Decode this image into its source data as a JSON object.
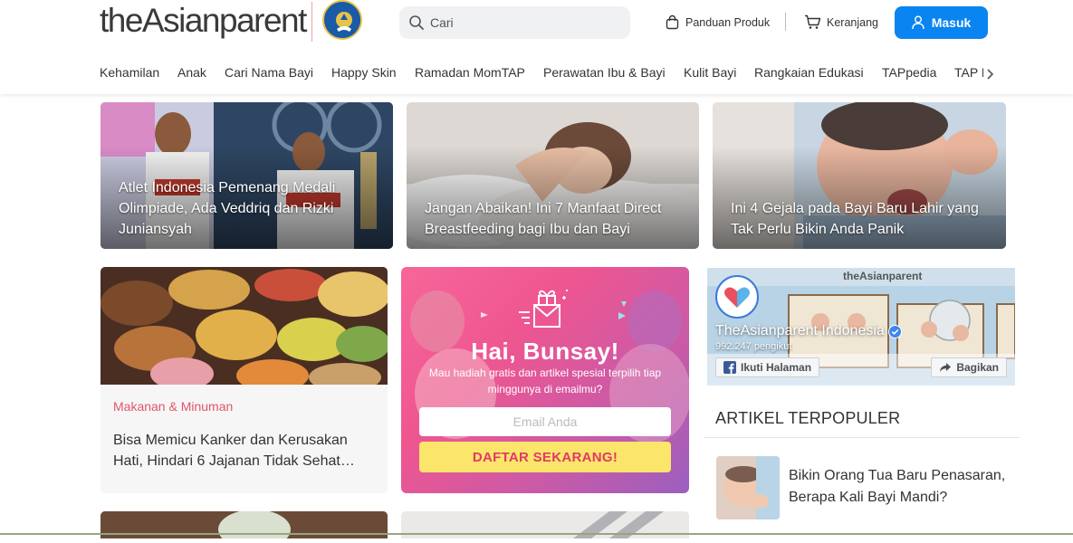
{
  "header": {
    "logo_text": "theAsianparent",
    "search": {
      "placeholder": "Cari",
      "value": ""
    },
    "links": {
      "guide": "Panduan Produk",
      "cart": "Keranjang"
    },
    "login_label": "Masuk",
    "accent_color": "#0a84f0"
  },
  "nav": {
    "items": [
      "Kehamilan",
      "Anak",
      "Cari Nama Bayi",
      "Happy Skin",
      "Ramadan MomTAP",
      "Perawatan Ibu & Bayi",
      "Kulit Bayi",
      "Rangkaian Edukasi",
      "TAPpedia",
      "TAP F"
    ]
  },
  "featured": [
    {
      "title": "Atlet Indonesia Pemenang Medali Olimpiade, Ada Veddriq dan Rizki Juniansyah"
    },
    {
      "title": "Jangan Abaikan! Ini 7 Manfaat Direct Breastfeeding bagi Ibu dan Bayi"
    },
    {
      "title": "Ini 4 Gejala pada Bayi Baru Lahir yang Tak Perlu Bikin Anda Panik"
    }
  ],
  "article_card": {
    "category": "Makanan & Minuman",
    "title": "Bisa Memicu Kanker dan Kerusakan Hati, Hindari 6 Jajanan Tidak Sehat…",
    "category_color": "#e2556a"
  },
  "newsletter": {
    "title": "Hai, Bunsay!",
    "subtitle": "Mau hadiah gratis dan artikel spesial terpilih tiap minggunya di emailmu?",
    "email_placeholder": "Email Anda",
    "button_label": "DAFTAR SEKARANG!"
  },
  "facebook": {
    "banner_brand": "theAsianparent",
    "page_name": "TheAsianparent Indonesia",
    "followers": "992.247 pengikut",
    "follow_label": "Ikuti Halaman",
    "share_label": "Bagikan"
  },
  "popular": {
    "heading": "ARTIKEL TERPOPULER",
    "items": [
      {
        "title": "Bikin Orang Tua Baru Penasaran, Berapa Kali Bayi Mandi?"
      }
    ]
  }
}
